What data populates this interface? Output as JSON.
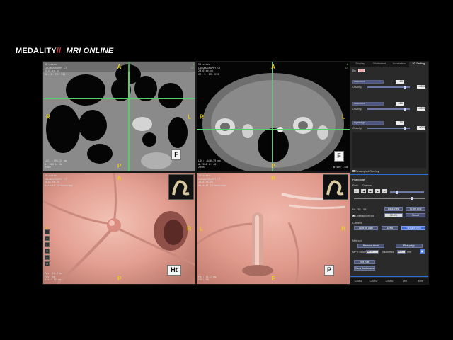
{
  "brand": {
    "name": "MEDALITY",
    "slash": "//",
    "product": "MRI ONLINE"
  },
  "viewports": {
    "top_left": {
      "orient": {
        "top": "A",
        "bottom": "P",
        "left": "R",
        "right": "L"
      },
      "overlay_tl": "ID:xxxxx\nCOLONOGRAPHY CT\n2016-xx-xx\nSE: 3  IM: 151",
      "overlay_tr": "A\nCT",
      "overlay_bl": "LOC: -196.23 mm\nW: 350 L: 40\nZoom",
      "overlay_br": "",
      "cube": "F"
    },
    "top_right": {
      "orient": {
        "top": "A",
        "bottom": "P",
        "left": "R",
        "right": "L"
      },
      "overlay_tl": "ID:xxxxx\nCOLONOGRAPHY CT\n2016-xx-xx\nSE: 3  IM: 232",
      "overlay_tr": "A\nCT",
      "overlay_bl": "LOC: -446.39 mm\nW: 350 L: 40\nZoom",
      "overlay_br": "W:400 L:40",
      "cube": "F"
    },
    "bottom_left": {
      "orient": {
        "top": "A",
        "bottom": "P",
        "left": "L",
        "right": "R"
      },
      "overlay_tl": "ID:xxxxx\nCOLONOGRAPHY CT\n2016-xx-xx\nVirtual Colonoscopy",
      "overlay_bl": "Pos: 24.3 mm\nFOV: 90\nDist: 12 mm",
      "cube": "Ht"
    },
    "bottom_right": {
      "orient": {
        "top": "H",
        "bottom": "F",
        "left": "L",
        "right": "R"
      },
      "overlay_tl": "ID:xxxxx\nCOLONOGRAPHY CT\n2016-xx-xx\nVirtual Colonoscopy",
      "overlay_bl": "Pos: 31.7 mm\nFOV: 90",
      "cube": "P"
    }
  },
  "panel": {
    "tabs": [
      "Display",
      "Worksheet",
      "Annotation",
      "3D Setting"
    ],
    "active_tab": "3D Setting",
    "color_label": "Bg",
    "layers": [
      {
        "name": "Isosurface",
        "value": "400",
        "opacity_label": "Opacity",
        "opacity": "1.0000"
      },
      {
        "name": "Isosurface",
        "value": "-300",
        "opacity_label": "Opacity",
        "opacity": "1.0000"
      },
      {
        "name": "Flythrough",
        "value": "-700",
        "opacity_label": "Opacity",
        "opacity": "1.0000"
      }
    ],
    "resample_label": "Resampled Overlay",
    "flythrough_title": "Flythrough",
    "sub_tabs": [
      "Path",
      "Options"
    ],
    "controls": [
      "⏮",
      "◀",
      "■",
      "▶",
      "⏭"
    ],
    "frame_label": "Fr: 781 / 951",
    "back_view": "Back View",
    "to_end": "To the End",
    "overlay_method": "Overlay Method",
    "overlay_pct": "50.0%",
    "unroll_label": "Unroll",
    "camera_label": "Camera",
    "lock_path": "Lock on path",
    "draw": "Draw",
    "forward_view": "Forward View",
    "method_label": "Method",
    "remove_block": "Remove block",
    "pick_polyp": "Pick polyp",
    "mpr_mode_label": "MPR Mode",
    "mpr_mode_value": "MPR",
    "thickness_label": "Thickness",
    "thickness_value": "1.0",
    "thickness_unit": "mm",
    "edit_path": "Edit Path",
    "show_bookmarks": "Show Bookmarks",
    "bottom_tabs": [
      "Colon1",
      "Colon2",
      "Colon3",
      "Mid",
      "Bone"
    ]
  },
  "tools": [
    "+",
    "−",
    "◐",
    "✥",
    "⌕",
    "↺"
  ],
  "colors": {
    "tissue": "#e5a396",
    "accent": "#2d6bd8",
    "orient": "#e8d21a"
  }
}
